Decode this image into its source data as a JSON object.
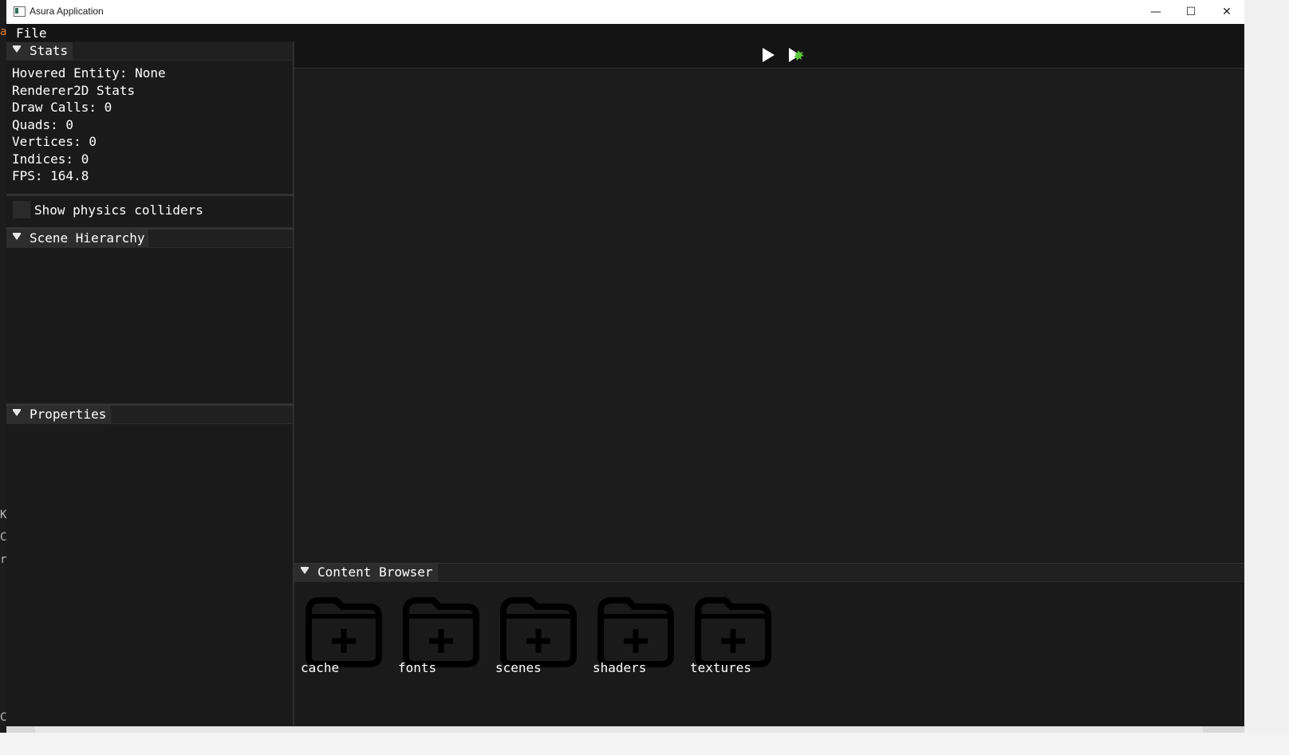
{
  "window": {
    "title": "Asura Application",
    "controls": {
      "minimize": "—",
      "maximize": "☐",
      "close": "✕"
    }
  },
  "menu": {
    "file": "File"
  },
  "stats": {
    "header": "Stats",
    "lines": [
      "Hovered Entity: None",
      "Renderer2D Stats",
      "Draw Calls: 0",
      "Quads: 0",
      "Vertices: 0",
      "Indices: 0",
      "FPS: 164.8"
    ],
    "show_colliders_label": "Show physics colliders",
    "show_colliders_checked": false
  },
  "scene_hierarchy": {
    "header": "Scene Hierarchy"
  },
  "properties": {
    "header": "Properties"
  },
  "toolbar": {
    "play_icon": "play-icon",
    "simulate_icon": "simulate-icon"
  },
  "content_browser": {
    "header": "Content Browser",
    "items": [
      "cache",
      "fonts",
      "scenes",
      "shaders",
      "textures"
    ]
  },
  "desktop_left_chars": [
    "a",
    "K",
    "C",
    "r",
    "C"
  ],
  "colors": {
    "accent_desktop": "#e07b30",
    "panel": "#1a1a1a",
    "header": "#2d2d2d",
    "sim_green": "#5cc83a"
  }
}
